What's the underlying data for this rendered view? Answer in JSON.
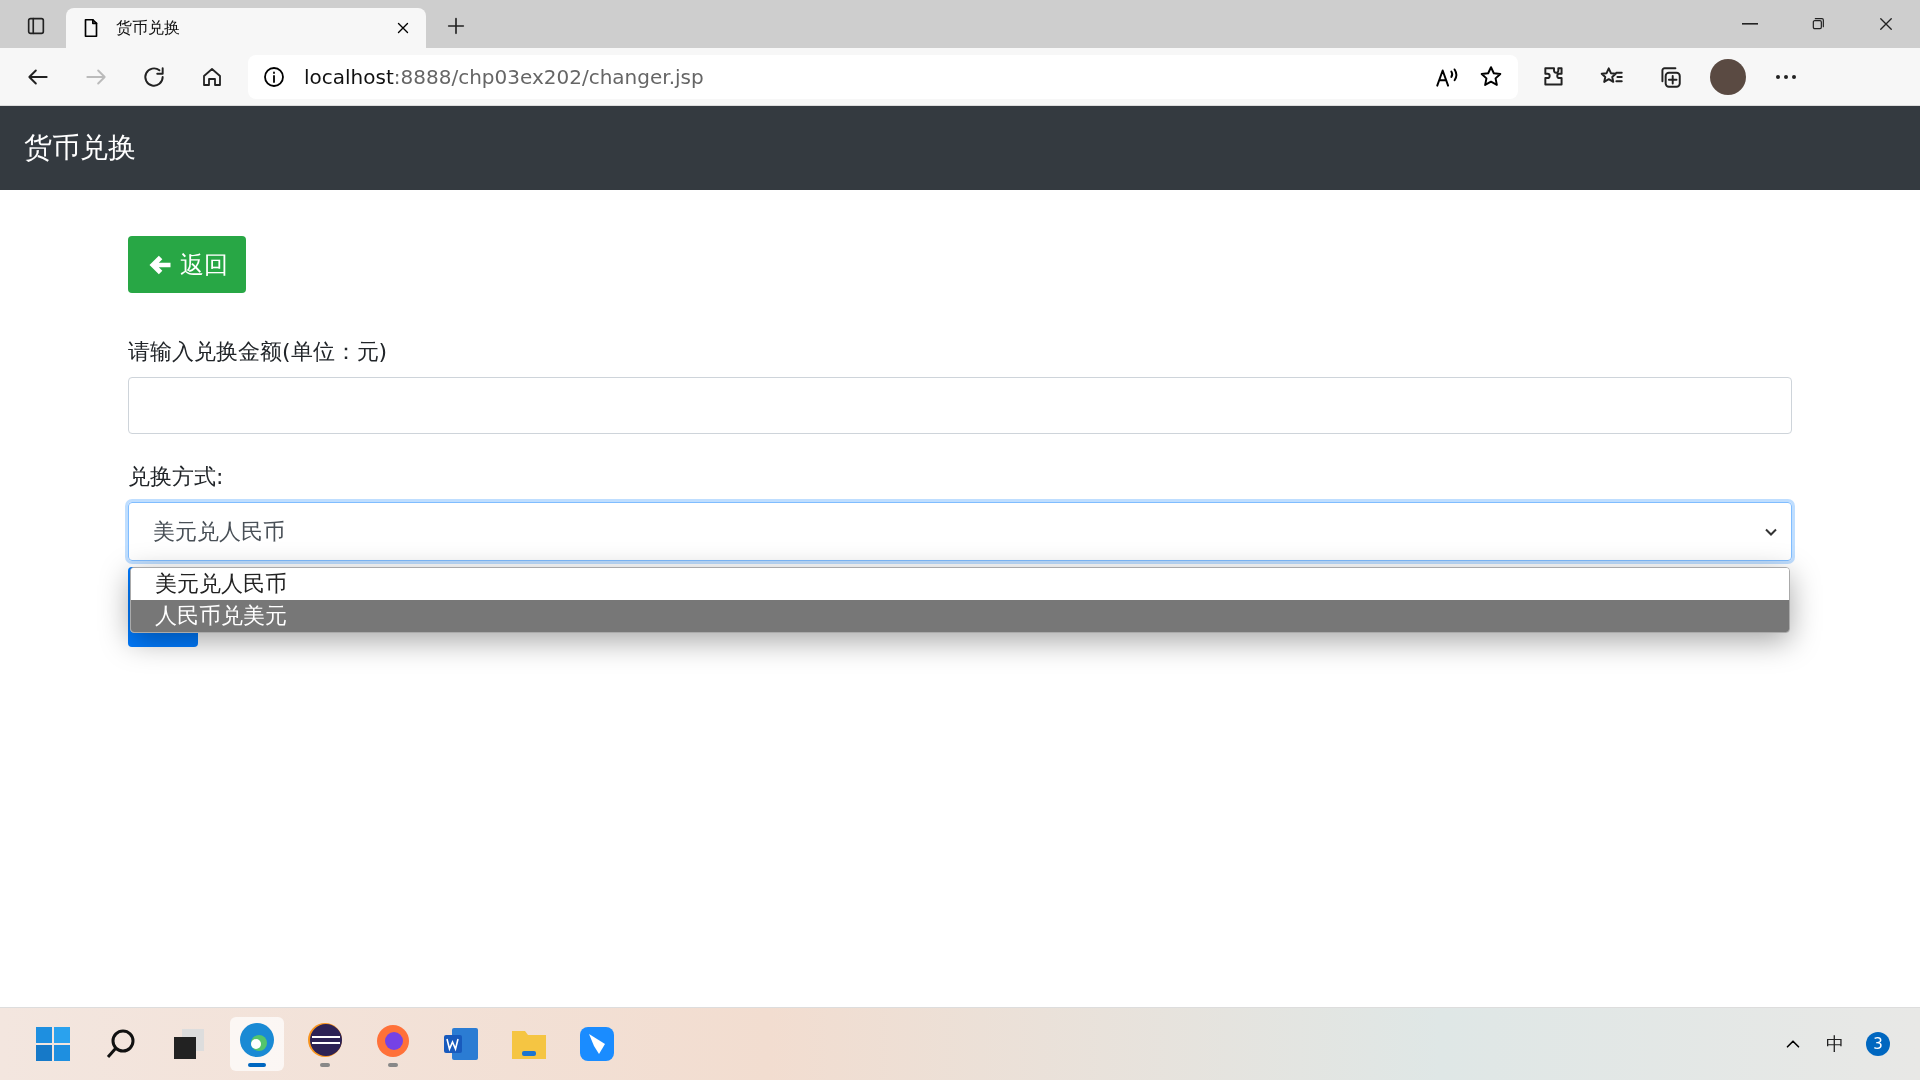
{
  "browser": {
    "tab_title": "货币兑换",
    "url_host": "localhost",
    "url_path": ":8888/chp03ex202/changer.jsp"
  },
  "navbar": {
    "title": "货币兑换"
  },
  "back_button": {
    "label": "返回"
  },
  "amount": {
    "label": "请输入兑换金额(单位：元)"
  },
  "mode": {
    "label": "兑换方式:",
    "value": "美元兑人民币",
    "expanded": true,
    "options": [
      {
        "label": "美元兑人民币",
        "selected": true,
        "highlighted": false
      },
      {
        "label": "人民币兑美元",
        "selected": false,
        "highlighted": true
      }
    ]
  },
  "taskbar": {
    "apps": [
      {
        "kind": "start"
      },
      {
        "kind": "search"
      },
      {
        "kind": "taskview"
      },
      {
        "kind": "edge",
        "active": true,
        "running": true
      },
      {
        "kind": "eclipse",
        "active": false,
        "running": true
      },
      {
        "kind": "firefox",
        "active": false,
        "running": true
      },
      {
        "kind": "word",
        "active": false,
        "running": false
      },
      {
        "kind": "folder",
        "active": false,
        "running": false
      },
      {
        "kind": "feishu",
        "active": false,
        "running": false
      }
    ],
    "ime": "中",
    "badge": "3"
  }
}
